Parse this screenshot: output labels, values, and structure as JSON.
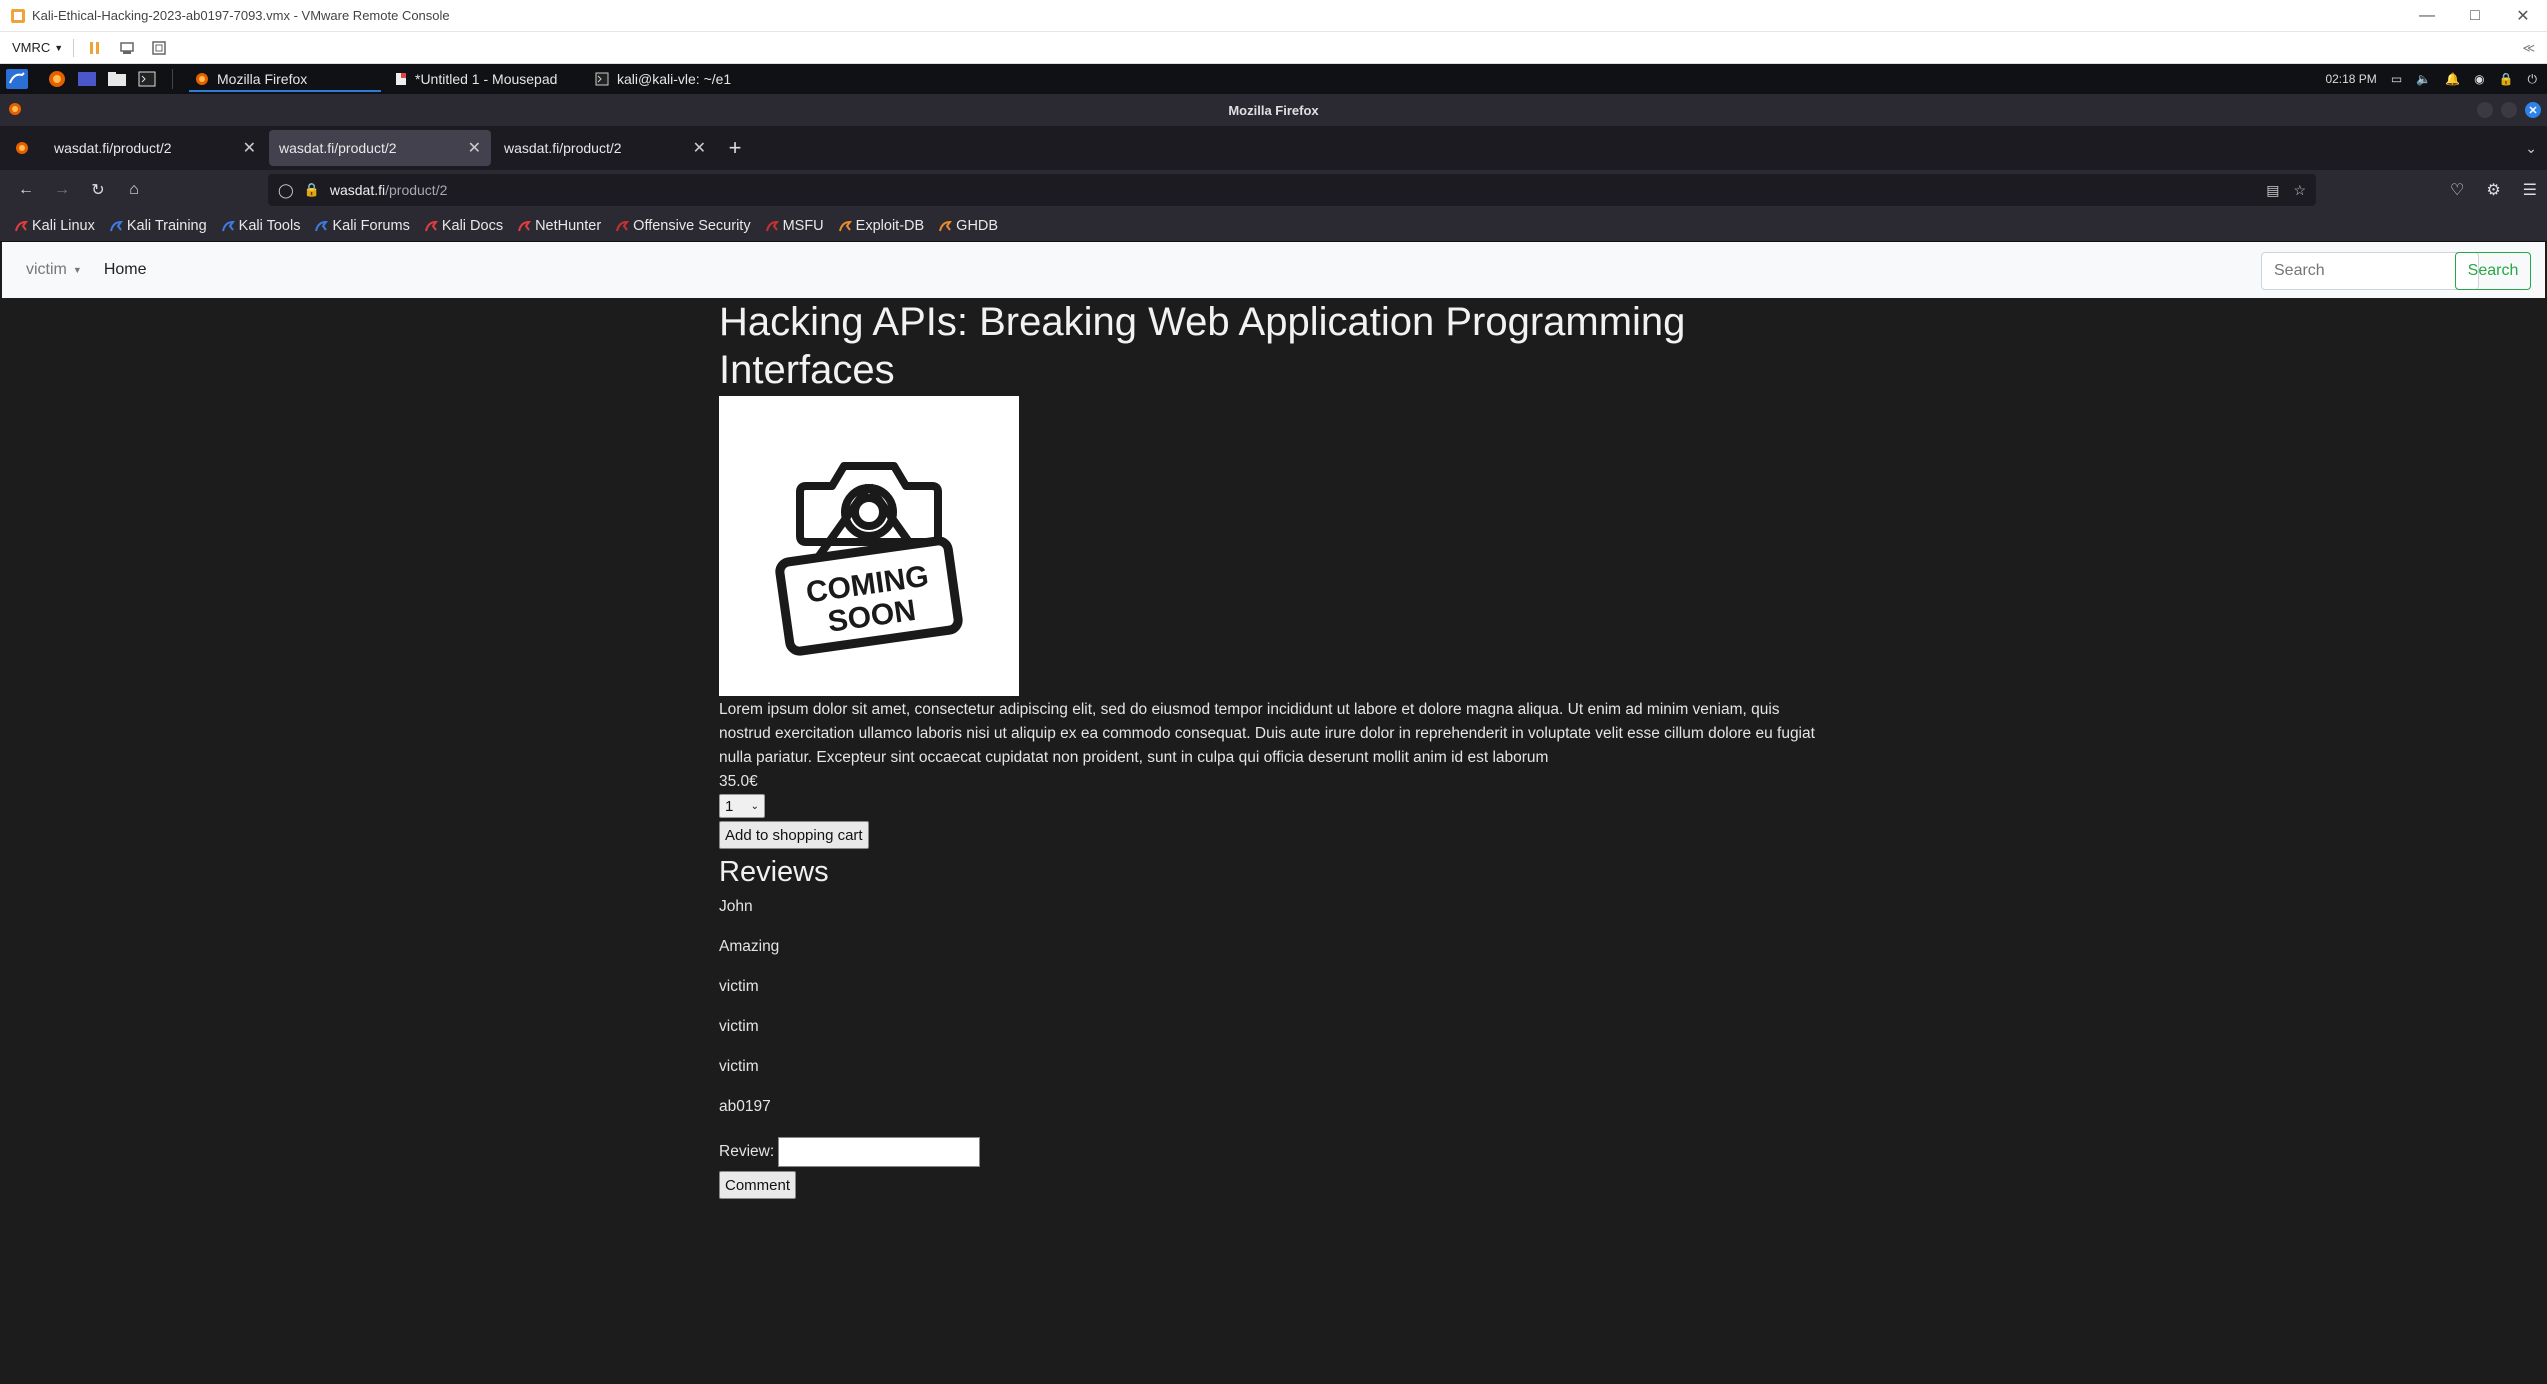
{
  "vm_window": {
    "title": "Kali-Ethical-Hacking-2023-ab0197-7093.vmx - VMware Remote Console",
    "menu_label": "VMRC",
    "collapse_icon": "collapse-icon"
  },
  "taskbar": {
    "tasks": [
      {
        "label": "Mozilla Firefox",
        "icon": "firefox-icon"
      },
      {
        "label": "*Untitled 1 - Mousepad",
        "icon": "mousepad-icon"
      },
      {
        "label": "kali@kali-vle: ~/e1",
        "icon": "terminal-icon"
      }
    ],
    "clock": "02:18 PM"
  },
  "browser": {
    "window_title": "Mozilla Firefox",
    "tabs": [
      {
        "label": "wasdat.fi/product/2",
        "active": false
      },
      {
        "label": "wasdat.fi/product/2",
        "active": true
      },
      {
        "label": "wasdat.fi/product/2",
        "active": false
      }
    ],
    "url": {
      "host": "wasdat.fi",
      "path": "/product/2"
    },
    "bookmarks": [
      {
        "label": "Kali Linux",
        "color": "#e23d3d"
      },
      {
        "label": "Kali Training",
        "color": "#3d7be2"
      },
      {
        "label": "Kali Tools",
        "color": "#3d7be2"
      },
      {
        "label": "Kali Forums",
        "color": "#3d7be2"
      },
      {
        "label": "Kali Docs",
        "color": "#e23d3d"
      },
      {
        "label": "NetHunter",
        "color": "#e23d3d"
      },
      {
        "label": "Offensive Security",
        "color": "#c7322f"
      },
      {
        "label": "MSFU",
        "color": "#c7322f"
      },
      {
        "label": "Exploit-DB",
        "color": "#e88b2d"
      },
      {
        "label": "GHDB",
        "color": "#e88b2d"
      }
    ]
  },
  "site": {
    "nav": {
      "user_menu": "victim",
      "home": "Home",
      "search_placeholder": "Search",
      "search_button": "Search"
    },
    "product": {
      "title": "Hacking APIs: Breaking Web Application Programming Interfaces",
      "image_text_line1": "COMING",
      "image_text_line2": "SOON",
      "description": "Lorem ipsum dolor sit amet, consectetur adipiscing elit, sed do eiusmod tempor incididunt ut labore et dolore magna aliqua. Ut enim ad minim veniam, quis nostrud exercitation ullamco laboris nisi ut aliquip ex ea commodo consequat. Duis aute irure dolor in reprehenderit in voluptate velit esse cillum dolore eu fugiat nulla pariatur. Excepteur sint occaecat cupidatat non proident, sunt in culpa qui officia deserunt mollit anim id est laborum",
      "price": "35.0€",
      "quantity": "1",
      "add_to_cart": "Add to shopping cart"
    },
    "reviews": {
      "heading": "Reviews",
      "items": [
        "John",
        "Amazing",
        "victim",
        "victim",
        "victim",
        "ab0197"
      ],
      "form_label": "Review:",
      "submit": "Comment"
    }
  }
}
